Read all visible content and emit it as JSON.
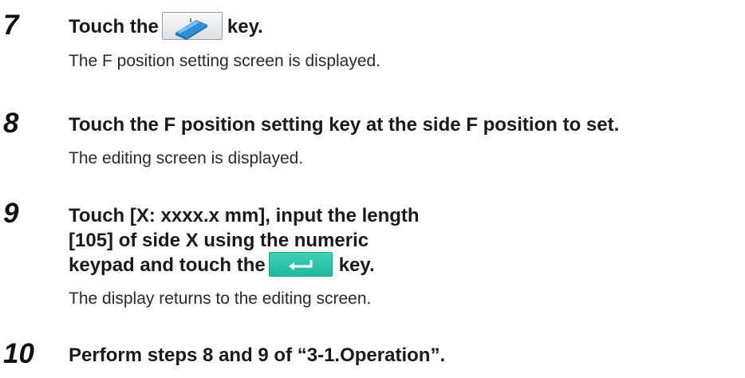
{
  "steps": [
    {
      "number": "7",
      "instruction_before": "Touch the",
      "key_icon": "f-position-key-icon",
      "instruction_after": "key.",
      "result": "The F position setting screen is displayed."
    },
    {
      "number": "8",
      "instruction": "Touch the F position setting key at the side F position to set.",
      "result": "The editing screen is displayed."
    },
    {
      "number": "9",
      "instruction_lines": [
        "Touch [X: xxxx.x mm], input the length",
        "[105] of side X using the numeric",
        "keypad and touch the"
      ],
      "key_icon": "enter-key-icon",
      "instruction_after": "key.",
      "result": "The display returns to the editing screen."
    },
    {
      "number": "10",
      "instruction": "Perform steps 8 and 9 of “3-1.Operation”."
    }
  ],
  "colors": {
    "enter_key": "#29c4a8",
    "f_position_icon": "#2f8fd8"
  }
}
